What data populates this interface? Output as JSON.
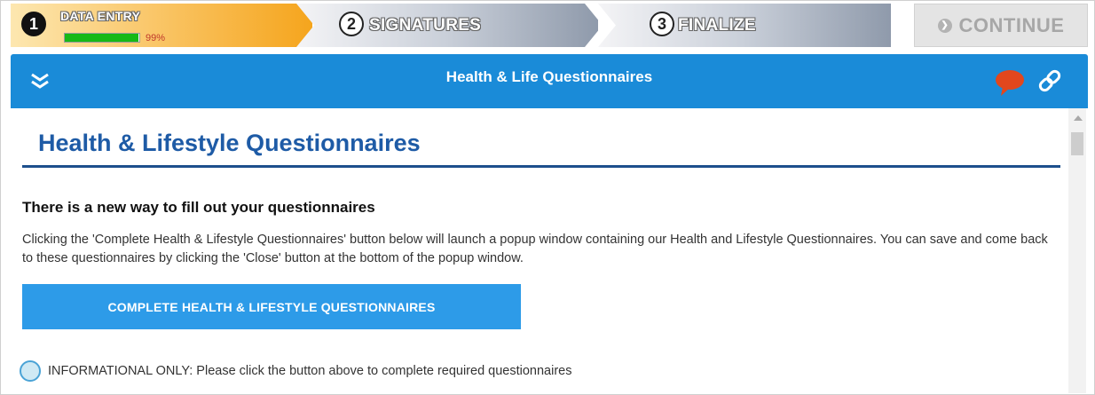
{
  "steps": [
    {
      "number": "1",
      "label": "DATA ENTRY",
      "progress_text": "99%",
      "progress": 0.99
    },
    {
      "number": "2",
      "label": "SIGNATURES"
    },
    {
      "number": "3",
      "label": "FINALIZE"
    }
  ],
  "continue_label": "CONTINUE",
  "header": {
    "title": "Health & Life Questionnaires",
    "icons": [
      "double-chevron-down-icon",
      "chat-bubble-icon",
      "link-icon"
    ]
  },
  "main": {
    "page_title": "Health & Lifestyle Questionnaires",
    "notice_heading": "There is a new way to fill out your questionnaires",
    "notice_body": "Clicking the 'Complete Health & Lifestyle Questionnaires' button below will launch a popup window containing our Health and Lifestyle Questionnaires. You can save and come back to these questionnaires by clicking the 'Close' button at the bottom of the popup window.",
    "primary_button": "COMPLETE HEALTH & LIFESTYLE QUESTIONNAIRES",
    "info_text": "INFORMATIONAL ONLY: Please click the button above to complete required questionnaires"
  },
  "colors": {
    "header_blue": "#1a8bd8",
    "button_blue": "#2d9be8",
    "title_blue": "#1e5ba6",
    "step_active": "#f5a51d",
    "progress_green": "#17b917",
    "chat_icon": "#e2471d"
  }
}
